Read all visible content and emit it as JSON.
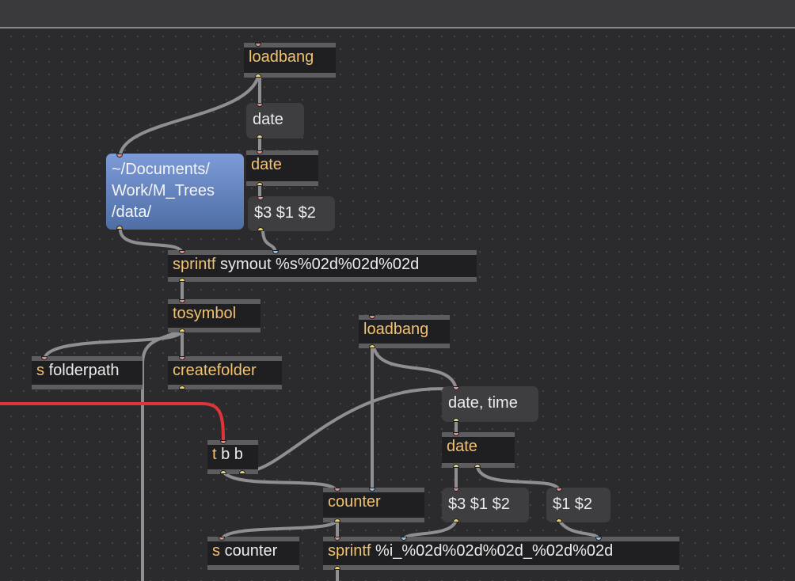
{
  "objects": {
    "loadbang_top": "loadbang",
    "date_obj_top": "date",
    "sprintf_top": {
      "kw": "sprintf",
      "args": "symout %s%02d%02d%02d"
    },
    "tosymbol": "tosymbol",
    "send_folderpath": {
      "kw": "s",
      "args": "folderpath"
    },
    "createfolder": "createfolder",
    "loadbang_mid": "loadbang",
    "trigger": {
      "kw": "t",
      "args": "b b"
    },
    "date_obj_mid": "date",
    "counter": "counter",
    "send_counter": {
      "kw": "s",
      "args": "counter"
    },
    "sprintf_bottom": {
      "kw": "sprintf",
      "args": "%i_%02d%02d%02d_%02d%02d"
    }
  },
  "messages": {
    "date_msg": "date",
    "swap_top": "$3 $1 $2",
    "date_time_msg": "date, time",
    "swap_mid": "$3 $1 $2",
    "pair_msg": "$1 $2",
    "path_lines": [
      "~/Documents/",
      "Work/M_Trees",
      "/data/"
    ]
  },
  "colors": {
    "background": "#2b2b2d",
    "object_fill": "#1f1f21",
    "object_border": "#5d5d60",
    "keyword": "#f2c270",
    "patch_cord": "#8f8f92",
    "selected_cord": "#e0343b",
    "path_message": "#6281bf"
  }
}
